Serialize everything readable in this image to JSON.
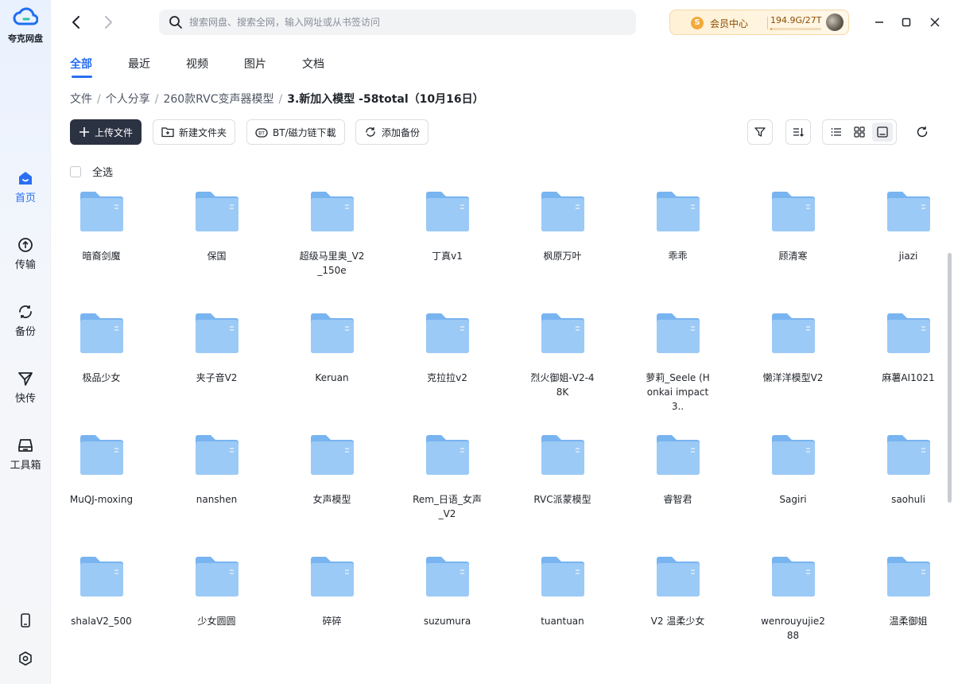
{
  "app": {
    "name": "夸克网盘"
  },
  "sidebar": {
    "items": [
      {
        "label": "首页",
        "icon": "home-icon",
        "active": true
      },
      {
        "label": "传输",
        "icon": "transfer-icon",
        "active": false
      },
      {
        "label": "备份",
        "icon": "backup-icon",
        "active": false
      },
      {
        "label": "快传",
        "icon": "send-icon",
        "active": false
      },
      {
        "label": "工具箱",
        "icon": "toolbox-icon",
        "active": false
      }
    ],
    "bottom_icons": [
      "phone-icon",
      "settings-icon"
    ]
  },
  "topbar": {
    "search_placeholder": "搜索网盘、搜索全网，输入网址或从书签访问",
    "vip_label": "会员中心",
    "vip_coin": "S",
    "storage": "194.9G/27T",
    "storage_ratio": 0.007,
    "accent": "#2a6ff2"
  },
  "tabs": [
    "全部",
    "最近",
    "视频",
    "图片",
    "文档"
  ],
  "breadcrumb": [
    "文件",
    "个人分享",
    "260款RVC变声器模型",
    "3.新加入模型 -58total（10月16日）"
  ],
  "toolbar": {
    "upload": "上传文件",
    "new_folder": "新建文件夹",
    "bt": "BT/磁力链下載",
    "backup": "添加备份"
  },
  "select_all": "全选",
  "folders": [
    "暗裔剑魔",
    "保国",
    "超级马里奥_V2_150e",
    "丁真v1",
    "枫原万叶",
    "乖乖",
    "顾清寒",
    "jiazi",
    "极品少女",
    "夹子音V2",
    "Keruan",
    "克拉拉v2",
    "烈火御姐-V2-48K",
    "萝莉_Seele (Honkai impact 3..",
    "懒洋洋模型V2",
    "麻薯AI1021",
    "MuQJ-moxing",
    "nanshen",
    "女声模型",
    "Rem_日语_女声_V2",
    "RVC派蒙模型",
    "睿智君",
    "Sagiri",
    "saohuli",
    "shalaV2_500",
    "少女圆圆",
    "碎碎",
    "suzumura",
    "tuantuan",
    "V2 温柔少女",
    "wenrouyujie288",
    "温柔御姐"
  ],
  "folder_color": "#78b4f0"
}
